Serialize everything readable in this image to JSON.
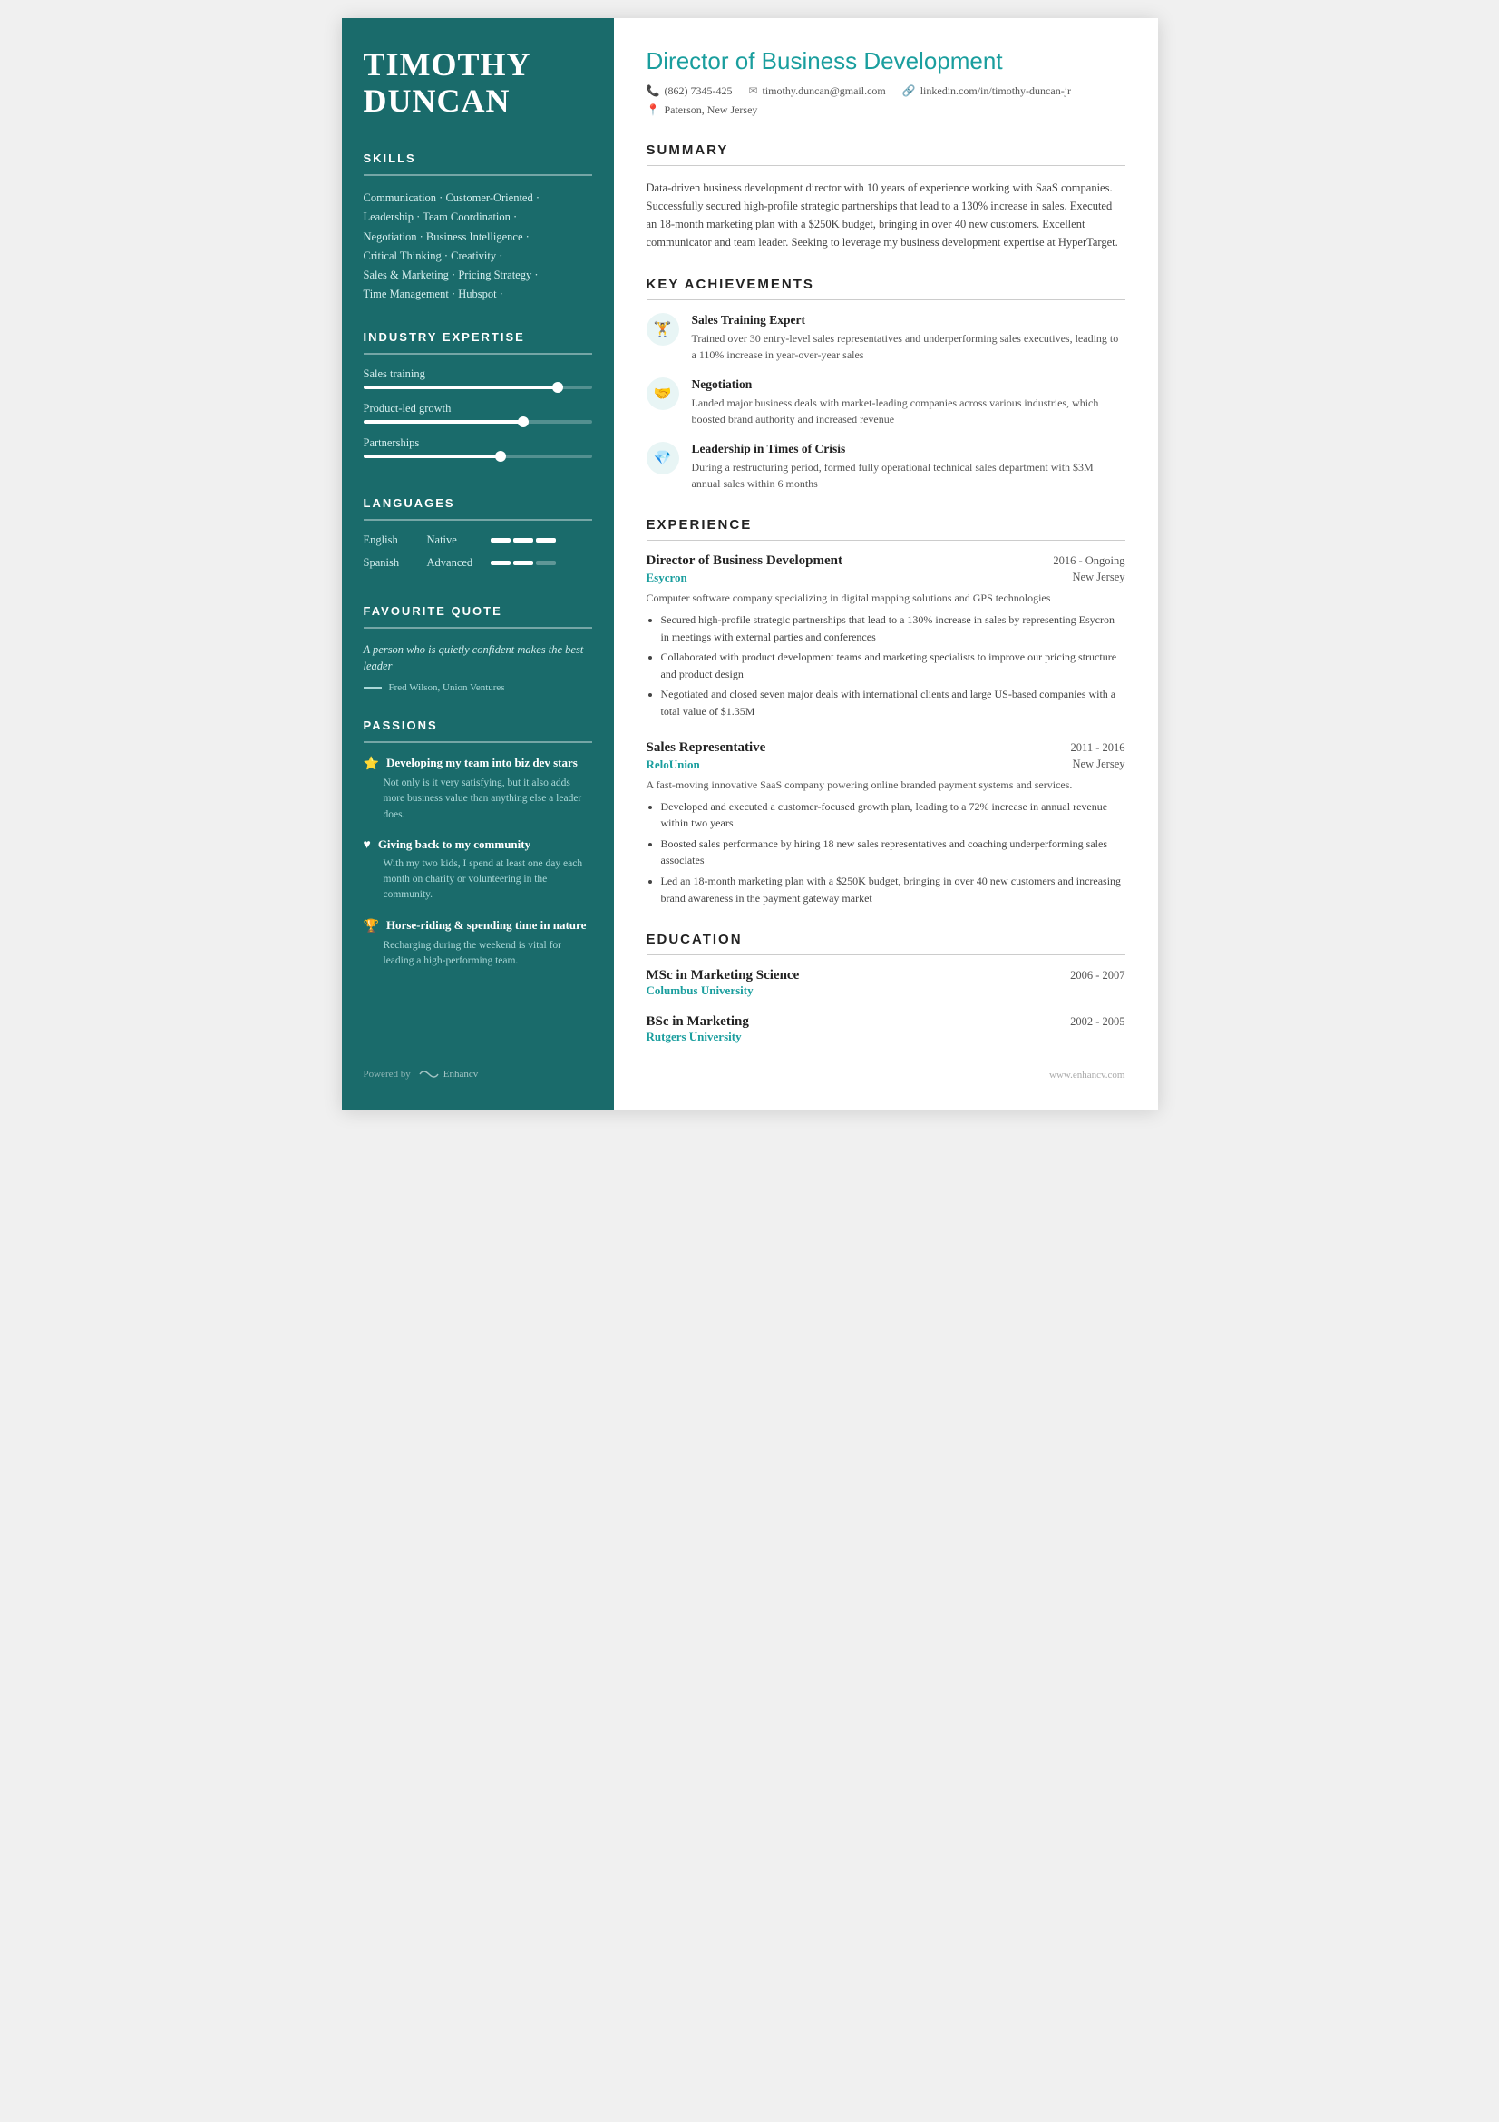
{
  "sidebar": {
    "name_line1": "TIMOTHY",
    "name_line2": "DUNCAN",
    "sections": {
      "skills": {
        "title": "SKILLS",
        "items": [
          "Communication · Customer-Oriented ·",
          "Leadership · Team Coordination ·",
          "Negotiation · Business Intelligence ·",
          "Critical Thinking · Creativity ·",
          "Sales & Marketing · Pricing Strategy ·",
          "Time Management · Hubspot ·"
        ]
      },
      "industry": {
        "title": "INDUSTRY EXPERTISE",
        "items": [
          {
            "label": "Sales training",
            "fill": 85
          },
          {
            "label": "Product-led growth",
            "fill": 70
          },
          {
            "label": "Partnerships",
            "fill": 60
          }
        ]
      },
      "languages": {
        "title": "LANGUAGES",
        "items": [
          {
            "name": "English",
            "level": "Native",
            "bars": 3,
            "filled": 3
          },
          {
            "name": "Spanish",
            "level": "Advanced",
            "bars": 3,
            "filled": 2
          }
        ]
      },
      "quote": {
        "title": "FAVOURITE QUOTE",
        "text": "A person who is quietly confident makes the best leader",
        "author": "Fred Wilson, Union Ventures"
      },
      "passions": {
        "title": "PASSIONS",
        "items": [
          {
            "icon": "⭐",
            "title": "Developing my team into biz dev stars",
            "desc": "Not only is it very satisfying, but it also adds more business value than anything else a leader does."
          },
          {
            "icon": "♥",
            "title": "Giving back to my community",
            "desc": "With my two kids, I spend at least one day each month on charity or volunteering in the community."
          },
          {
            "icon": "🏆",
            "title": "Horse-riding & spending time in nature",
            "desc": "Recharging during the weekend is vital for leading a high-performing team."
          }
        ]
      }
    },
    "footer": {
      "powered_by": "Powered by",
      "brand": "Enhancv"
    }
  },
  "main": {
    "title": "Director of Business Development",
    "contact": {
      "phone": "(862) 7345-425",
      "email": "timothy.duncan@gmail.com",
      "linkedin": "linkedin.com/in/timothy-duncan-jr",
      "location": "Paterson, New Jersey"
    },
    "summary": {
      "title": "SUMMARY",
      "text": "Data-driven business development director with 10 years of experience working with SaaS companies. Successfully secured high-profile strategic partnerships that lead to a 130% increase in sales. Executed an 18-month marketing plan with a $250K budget, bringing in over 40 new customers. Excellent communicator and team leader. Seeking to leverage my business development expertise at HyperTarget."
    },
    "achievements": {
      "title": "KEY ACHIEVEMENTS",
      "items": [
        {
          "icon": "🏋",
          "title": "Sales Training Expert",
          "desc": "Trained over 30 entry-level sales representatives and underperforming sales executives, leading to a 110% increase in year-over-year sales"
        },
        {
          "icon": "🤝",
          "title": "Negotiation",
          "desc": "Landed major business deals with market-leading companies across various industries, which boosted brand authority and increased revenue"
        },
        {
          "icon": "💎",
          "title": "Leadership in Times of Crisis",
          "desc": "During a restructuring period, formed fully operational technical sales department with $3M annual sales within 6 months"
        }
      ]
    },
    "experience": {
      "title": "EXPERIENCE",
      "items": [
        {
          "title": "Director of Business Development",
          "dates": "2016 - Ongoing",
          "company": "Esycron",
          "location": "New Jersey",
          "desc": "Computer software company specializing in digital mapping solutions and GPS technologies",
          "bullets": [
            "Secured high-profile strategic partnerships that lead to a 130% increase in sales by representing Esycron in meetings with external parties and conferences",
            "Collaborated with product development teams and marketing specialists to improve our pricing structure and product design",
            "Negotiated and closed seven major deals with international clients and large US-based companies with a total value of $1.35M"
          ]
        },
        {
          "title": "Sales Representative",
          "dates": "2011 - 2016",
          "company": "ReloUnion",
          "location": "New Jersey",
          "desc": "A fast-moving innovative SaaS company powering online branded payment systems and services.",
          "bullets": [
            "Developed and executed a customer-focused growth plan, leading to a 72% increase in annual revenue within two years",
            "Boosted sales performance by hiring 18 new sales representatives and coaching underperforming sales associates",
            "Led an 18-month marketing plan with a $250K budget, bringing in over 40 new customers and increasing brand awareness in the payment gateway market"
          ]
        }
      ]
    },
    "education": {
      "title": "EDUCATION",
      "items": [
        {
          "degree": "MSc in Marketing Science",
          "dates": "2006 - 2007",
          "school": "Columbus University"
        },
        {
          "degree": "BSc in Marketing",
          "dates": "2002 - 2005",
          "school": "Rutgers University"
        }
      ]
    },
    "footer": {
      "website": "www.enhancv.com"
    }
  }
}
